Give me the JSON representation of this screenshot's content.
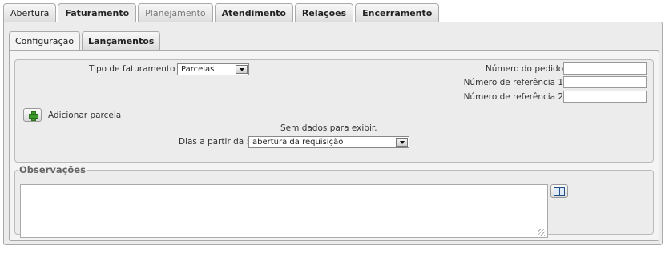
{
  "tabs": [
    {
      "label": "Abertura",
      "state": "normal"
    },
    {
      "label": "Faturamento",
      "state": "active"
    },
    {
      "label": "Planejamento",
      "state": "muted"
    },
    {
      "label": "Atendimento",
      "state": "normal"
    },
    {
      "label": "Relações",
      "state": "normal"
    },
    {
      "label": "Encerramento",
      "state": "normal"
    }
  ],
  "subtabs": [
    {
      "label": "Configuração",
      "state": "active"
    },
    {
      "label": "Lançamentos",
      "state": "normal"
    }
  ],
  "config": {
    "tipo_faturamento_label": "Tipo de faturamento :",
    "tipo_faturamento_value": "Parcelas",
    "numero_pedido_label": "Número do pedido :",
    "numero_pedido_value": "",
    "numero_ref1_label": "Número de referência 1 :",
    "numero_ref1_value": "",
    "numero_ref2_label": "Número de referência 2 :",
    "numero_ref2_value": "",
    "adicionar_parcela_label": "Adicionar parcela",
    "sem_dados": "Sem dados para exibir.",
    "dias_label": "Dias a partir da :",
    "dias_value": "abertura da requisição"
  },
  "observacoes": {
    "legend": "Observações",
    "value": ""
  },
  "icons": {
    "add": "plus-icon",
    "book": "book-icon",
    "dropdown": "chevron-down-icon",
    "resize": "resize-grip-icon"
  },
  "colors": {
    "panel": "#ececec",
    "accent_green": "#3a9a2a",
    "book_blue": "#1f4f8a"
  }
}
